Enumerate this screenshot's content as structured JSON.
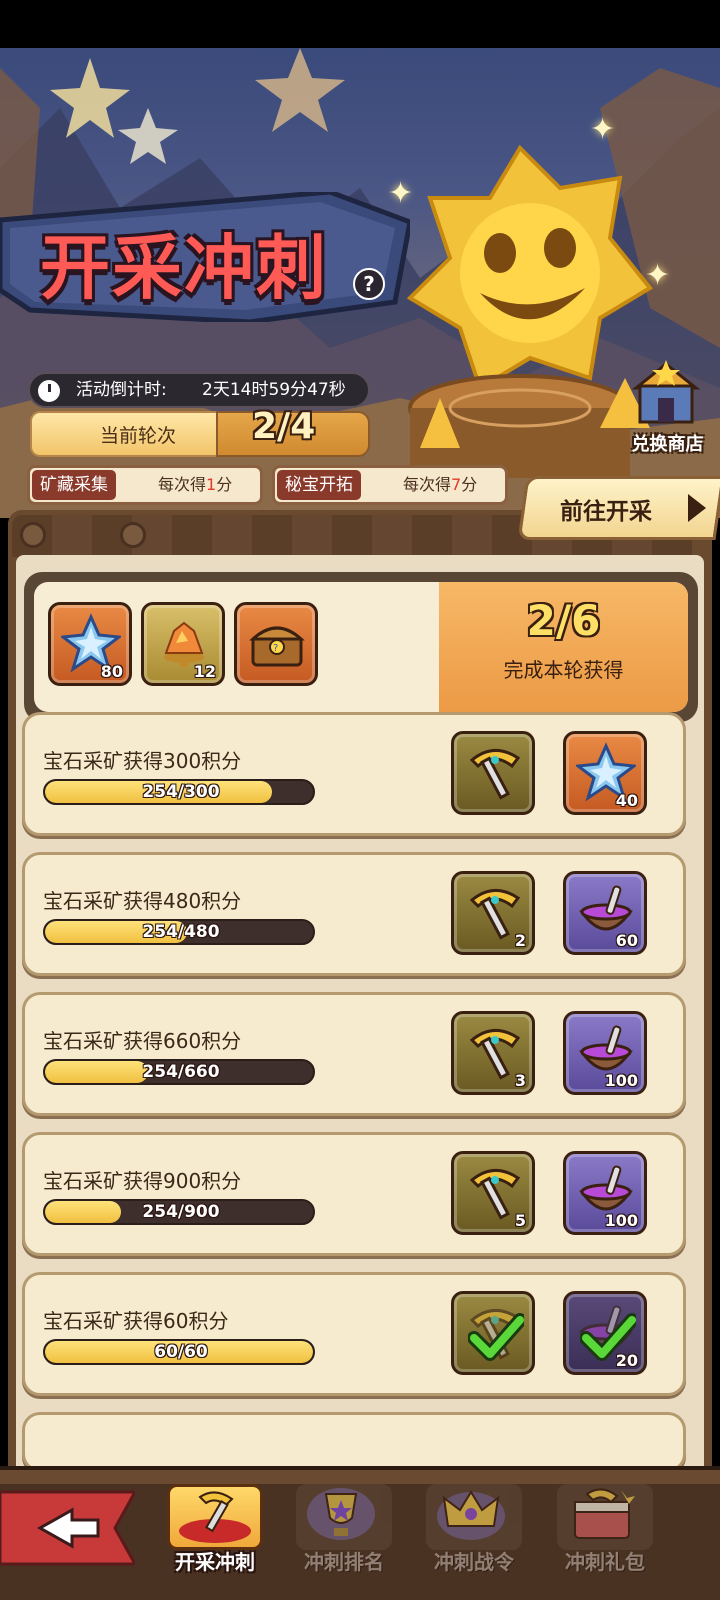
{
  "header": {
    "title": "开采冲刺",
    "help_label": "?",
    "timer_label": "活动倒计时:",
    "timer_value": "2天14时59分47秒",
    "round_label": "当前轮次",
    "round_value": "2/4",
    "shop_label": "兑换商店"
  },
  "score_rules": [
    {
      "tag": "矿藏采集",
      "prefix": "每次得",
      "points": "1",
      "suffix": "分",
      "tag_color": "#8a3a2a"
    },
    {
      "tag": "秘宝开拓",
      "prefix": "每次得",
      "points": "7",
      "suffix": "分",
      "tag_color": "#8a3a2a"
    }
  ],
  "go_mine_label": "前往开采",
  "round_reward": {
    "items": [
      {
        "icon": "blue-star-gem-icon",
        "count": "80",
        "tile": "orange"
      },
      {
        "icon": "gold-ore-pile-icon",
        "count": "12",
        "tile": "gold"
      },
      {
        "icon": "treasure-chest-icon",
        "count": "",
        "tile": "orange"
      }
    ],
    "progress": "2/6",
    "caption": "完成本轮获得"
  },
  "tasks": [
    {
      "title": "宝石采矿获得300积分",
      "progress_text": "254/300",
      "progress": 0.847,
      "completed": false,
      "rewards": [
        {
          "icon": "gold-pickaxe-icon",
          "count": "",
          "tile": "olive"
        },
        {
          "icon": "blue-star-gem-icon",
          "count": "40",
          "tile": "orange"
        }
      ]
    },
    {
      "title": "宝石采矿获得480积分",
      "progress_text": "254/480",
      "progress": 0.529,
      "completed": false,
      "rewards": [
        {
          "icon": "gold-pickaxe-icon",
          "count": "2",
          "tile": "olive"
        },
        {
          "icon": "potion-bowl-icon",
          "count": "60",
          "tile": "purple"
        }
      ]
    },
    {
      "title": "宝石采矿获得660积分",
      "progress_text": "254/660",
      "progress": 0.385,
      "completed": false,
      "rewards": [
        {
          "icon": "gold-pickaxe-icon",
          "count": "3",
          "tile": "olive"
        },
        {
          "icon": "potion-bowl-icon",
          "count": "100",
          "tile": "purple"
        }
      ]
    },
    {
      "title": "宝石采矿获得900积分",
      "progress_text": "254/900",
      "progress": 0.282,
      "completed": false,
      "rewards": [
        {
          "icon": "gold-pickaxe-icon",
          "count": "5",
          "tile": "olive"
        },
        {
          "icon": "potion-bowl-icon",
          "count": "100",
          "tile": "purple"
        }
      ]
    },
    {
      "title": "宝石采矿获得60积分",
      "progress_text": "60/60",
      "progress": 1.0,
      "completed": true,
      "rewards": [
        {
          "icon": "gold-pickaxe-icon",
          "count": "",
          "tile": "olive"
        },
        {
          "icon": "potion-bowl-icon",
          "count": "20",
          "tile": "dpurple"
        }
      ]
    }
  ],
  "nav": {
    "back_icon": "back-arrow-icon",
    "items": [
      {
        "label": "开采冲刺",
        "icon": "pickaxe-cushion-icon",
        "active": true
      },
      {
        "label": "冲刺排名",
        "icon": "trophy-icon",
        "active": false
      },
      {
        "label": "冲刺战令",
        "icon": "crown-icon",
        "active": false
      },
      {
        "label": "冲刺礼包",
        "icon": "gift-pack-icon",
        "active": false
      }
    ]
  }
}
